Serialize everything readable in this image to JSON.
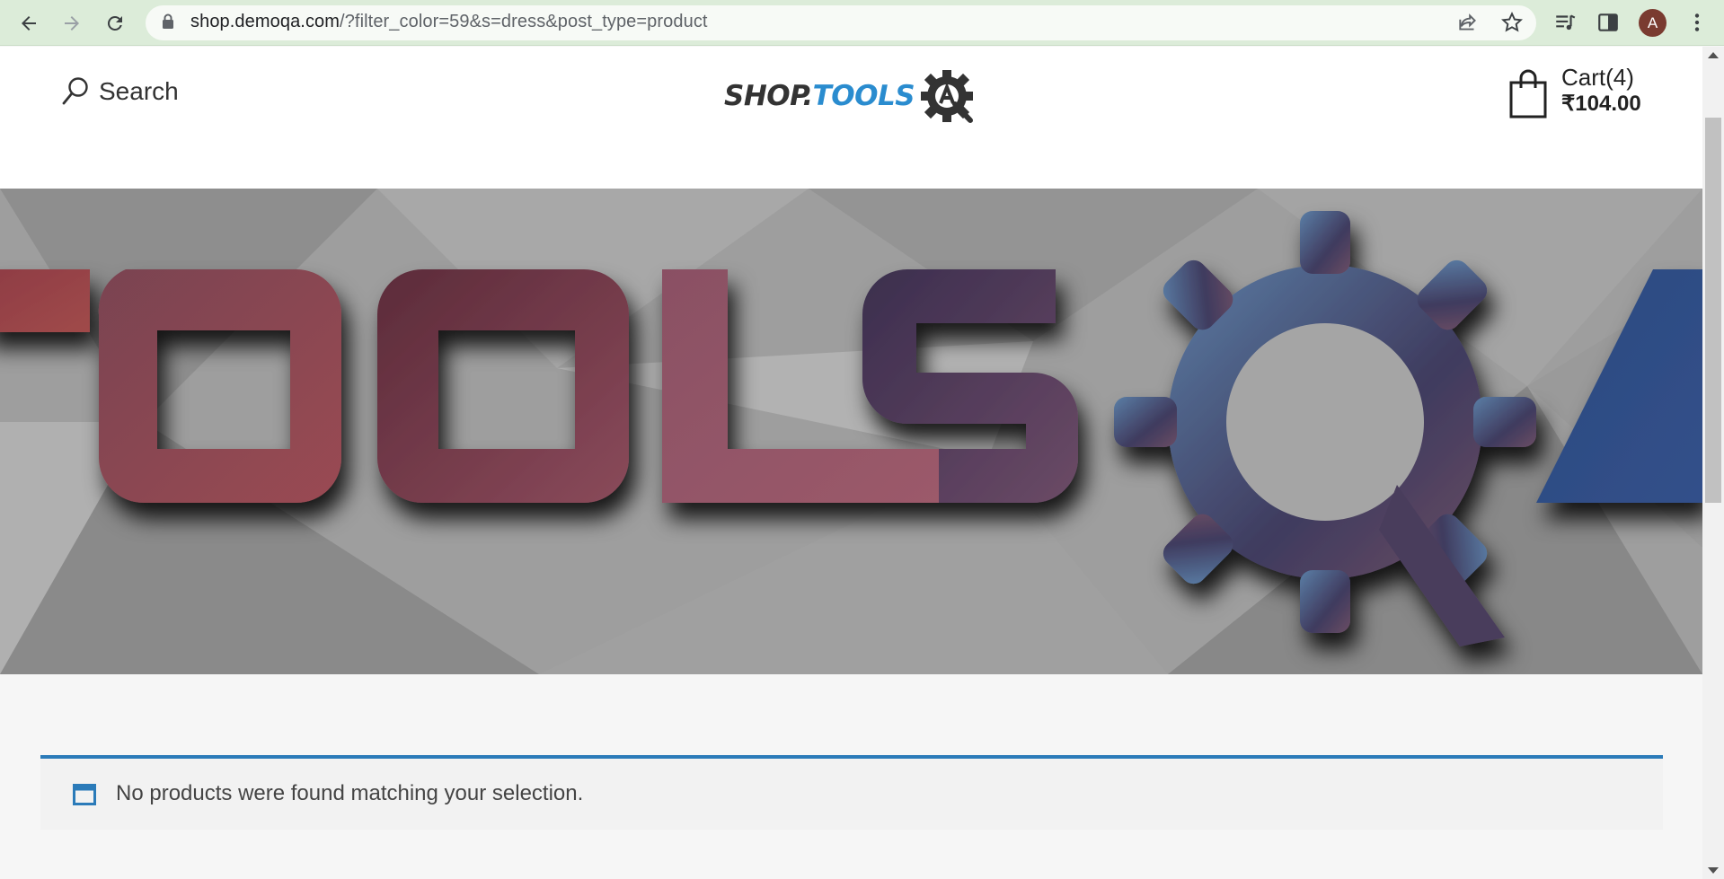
{
  "browser": {
    "url_host": "shop.demoqa.com",
    "url_rest": "/?filter_color=59&s=dress&post_type=product",
    "avatar_letter": "A",
    "icons": [
      "back-arrow-icon",
      "forward-arrow-icon",
      "reload-icon",
      "lock-icon",
      "share-icon",
      "star-icon",
      "media-icon",
      "side-panel-icon",
      "kebab-menu-icon"
    ]
  },
  "header": {
    "search_label": "Search",
    "logo_shop": "SHOP.",
    "logo_tools": "TOOLS",
    "cart_title": "Cart(4)",
    "cart_total": "₹104.00"
  },
  "banner": {
    "letters": [
      "T",
      "O",
      "O",
      "L",
      "S",
      "Q",
      "A"
    ]
  },
  "notice": {
    "message": "No products were found matching your selection."
  },
  "colors": {
    "chrome_bg": "#dcecd9",
    "accent_blue": "#2b7bb9",
    "logo_blue": "#2a8ccf",
    "avatar_bg": "#7a3b30"
  }
}
